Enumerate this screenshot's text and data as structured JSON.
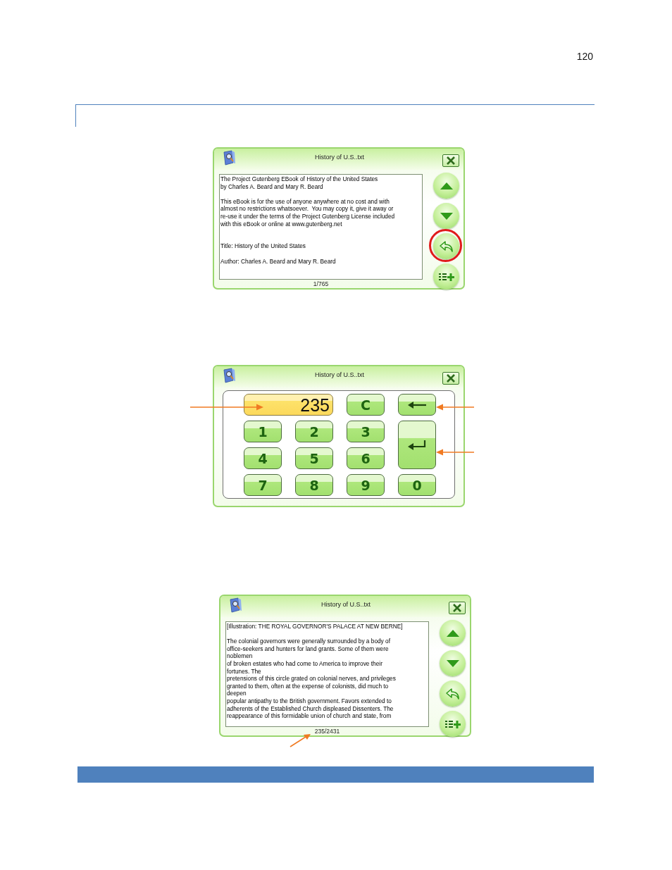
{
  "page_number": "120",
  "figures": [
    {
      "kind": "reader",
      "title": "History of U.S..txt",
      "text_blocks": [
        {
          "wide_gap_before": false,
          "lines": [
            "The Project Gutenberg EBook of History of the United States",
            "by Charles A. Beard and Mary R. Beard"
          ]
        },
        {
          "wide_gap_before": false,
          "lines": [
            "This eBook is for the use of anyone anywhere at no cost and with",
            "almost no restrictions whatsoever.  You may copy it, give it away or",
            "re-use it under the terms of the Project Gutenberg License included",
            "with this eBook or online at www.gutenberg.net"
          ]
        },
        {
          "wide_gap_before": true,
          "lines": [
            "Title: History of the United States"
          ]
        },
        {
          "wide_gap_before": false,
          "lines": [
            "Author: Charles A. Beard and Mary R. Beard"
          ]
        }
      ],
      "page_indicator": "1/765",
      "page_indicator_marked": false,
      "back_button_circled": true
    },
    {
      "kind": "keypad",
      "title": "History of U.S..txt",
      "display": "235",
      "display_marked": true,
      "keys": [
        {
          "kind": "text",
          "label": "C",
          "marked": false
        },
        {
          "kind": "backspace",
          "marked": true
        },
        {
          "kind": "text",
          "label": "1",
          "marked": false
        },
        {
          "kind": "text",
          "label": "2",
          "marked": false
        },
        {
          "kind": "text",
          "label": "3",
          "marked": false
        },
        {
          "kind": "enter",
          "marked": true
        },
        {
          "kind": "text",
          "label": "4",
          "marked": false
        },
        {
          "kind": "text",
          "label": "5",
          "marked": false
        },
        {
          "kind": "text",
          "label": "6",
          "marked": false
        },
        {
          "kind": "text",
          "label": "7",
          "marked": false
        },
        {
          "kind": "text",
          "label": "8",
          "marked": false
        },
        {
          "kind": "text",
          "label": "9",
          "marked": false
        },
        {
          "kind": "text",
          "label": "0",
          "marked": false
        }
      ]
    },
    {
      "kind": "reader",
      "title": "History of U.S..txt",
      "text_blocks": [
        {
          "wide_gap_before": false,
          "lines": [
            "[Illustration: THE ROYAL GOVERNOR'S PALACE AT NEW BERNE]"
          ]
        },
        {
          "wide_gap_before": false,
          "lines": [
            "The colonial governors were generally surrounded by a body of",
            "office-seekers and hunters for land grants. Some of them were",
            "noblemen",
            "of broken estates who had come to America to improve their",
            "fortunes. The",
            "pretensions of this circle grated on colonial nerves, and privileges",
            "granted to them, often at the expense of colonists, did much to",
            "deepen",
            "popular antipathy to the British government. Favors extended to",
            "adherents of the Established Church displeased Dissenters. The",
            "reappearance of this formidable union of church and state, from"
          ]
        }
      ],
      "page_indicator": "235/2431",
      "page_indicator_marked": true,
      "back_button_circled": false
    }
  ]
}
